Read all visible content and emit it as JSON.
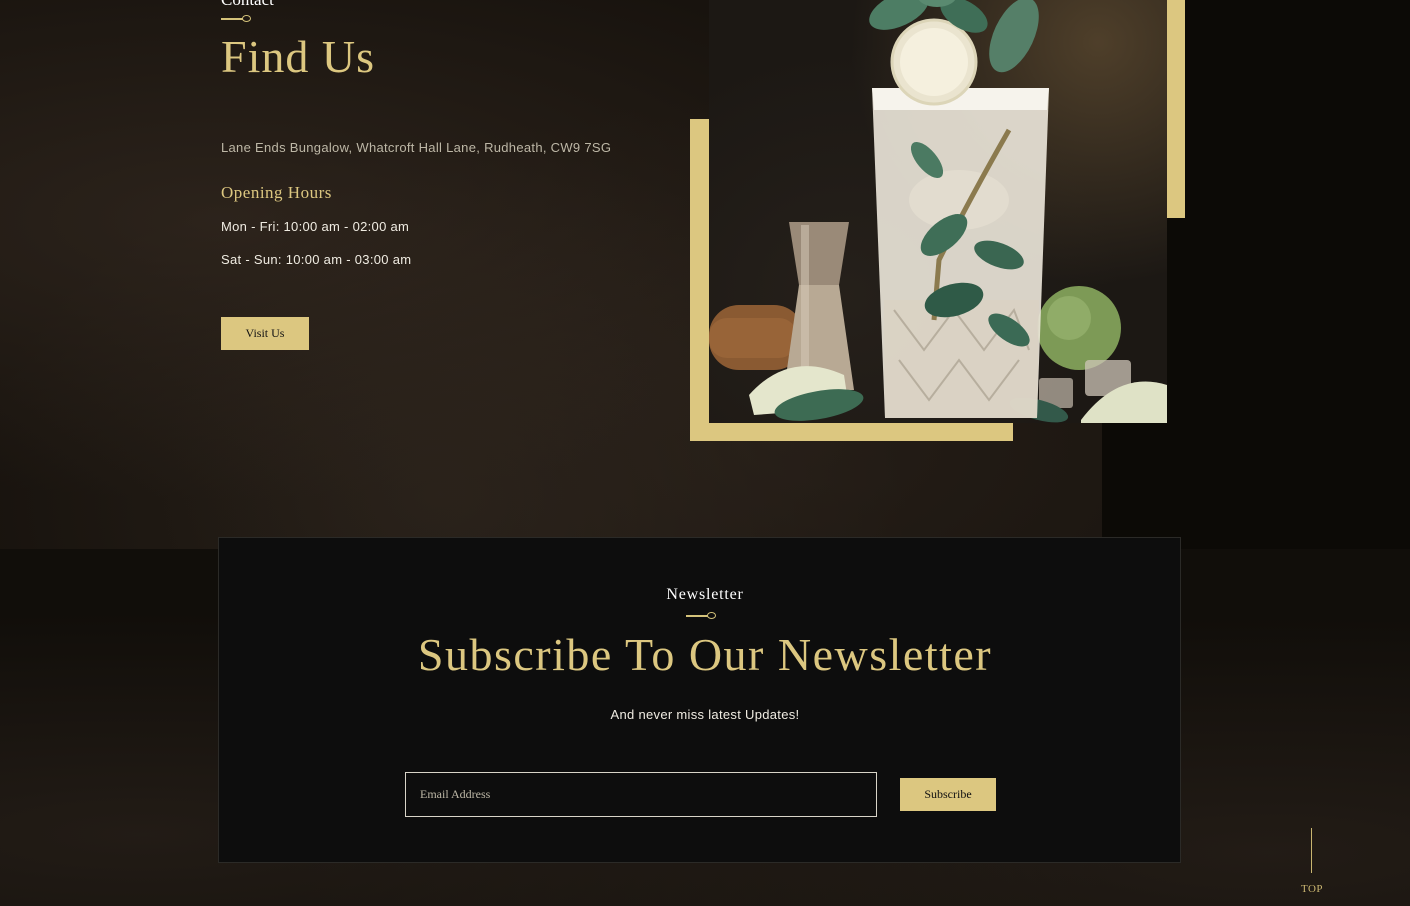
{
  "contact": {
    "eyebrow": "Contact",
    "title": "Find Us",
    "address": "Lane Ends Bungalow, Whatcroft Hall Lane, Rudheath, CW9 7SG",
    "hours_title": "Opening Hours",
    "hours": [
      "Mon - Fri: 10:00 am - 02:00 am",
      "Sat - Sun: 10:00 am - 03:00 am"
    ],
    "visit_button": "Visit Us"
  },
  "newsletter": {
    "eyebrow": "Newsletter",
    "title": "Subscribe To Our Newsletter",
    "subtitle": "And never miss latest Updates!",
    "email_placeholder": "Email Address",
    "subscribe_button": "Subscribe"
  },
  "back_to_top": "TOP",
  "colors": {
    "accent_gold": "#dcc780",
    "background_dark": "#0d0b07",
    "panel": "#0d0d0d"
  }
}
